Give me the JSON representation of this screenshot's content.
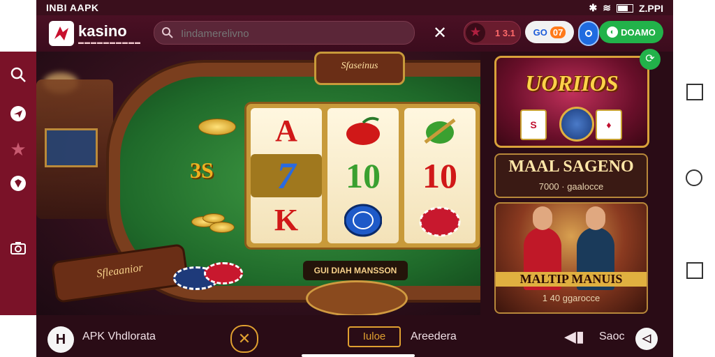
{
  "status_bar": {
    "left_text": "INBI AAPK",
    "time": "Z.PPI"
  },
  "header": {
    "logo_text": "kasino",
    "logo_sub": "",
    "search_placeholder": "Iindamerelivno",
    "close_icon": "close-icon",
    "star_count": "1 3.1",
    "score_left": "GO",
    "score_badge": "07",
    "green_pill_label": "DOAMO",
    "colors": {
      "header_bg": "#4a1024",
      "rail": "#7a1228",
      "green": "#22b24a",
      "blue": "#1f6be0"
    }
  },
  "rail": {
    "items": [
      "search-icon",
      "plane-icon",
      "star-icon",
      "shield-icon",
      "camera-icon"
    ]
  },
  "game": {
    "title_plaque": "Sfaseinus",
    "left_sign": "Sfleaanior",
    "bottom_label": "GUI DIAH MANSSON",
    "ss_label": "3S",
    "reels": [
      [
        "A",
        "cherry",
        "K"
      ],
      [
        "7",
        "10",
        "chip"
      ],
      [
        "bell",
        "10",
        "chip"
      ]
    ],
    "reel_symbols_text": {
      "a": "A",
      "seven": "7",
      "k": "K",
      "ten_mid": "10",
      "ten_right": "10"
    }
  },
  "right_panel": {
    "promo_title": "UORIIOS",
    "promo_card_left": "S",
    "info_card_1": {
      "title": "MAAL SAGENO",
      "line": "7000 · gaalocce"
    },
    "photo_card": {
      "title": "MALTIP MANUIS",
      "line": "1 40 ggarocce"
    }
  },
  "bottom_bar": {
    "app_label": "APK Vhdlorata",
    "center_button": "Iuloe",
    "free_label": "Areedera",
    "right_label": "Saoc",
    "left_circle": "H"
  }
}
